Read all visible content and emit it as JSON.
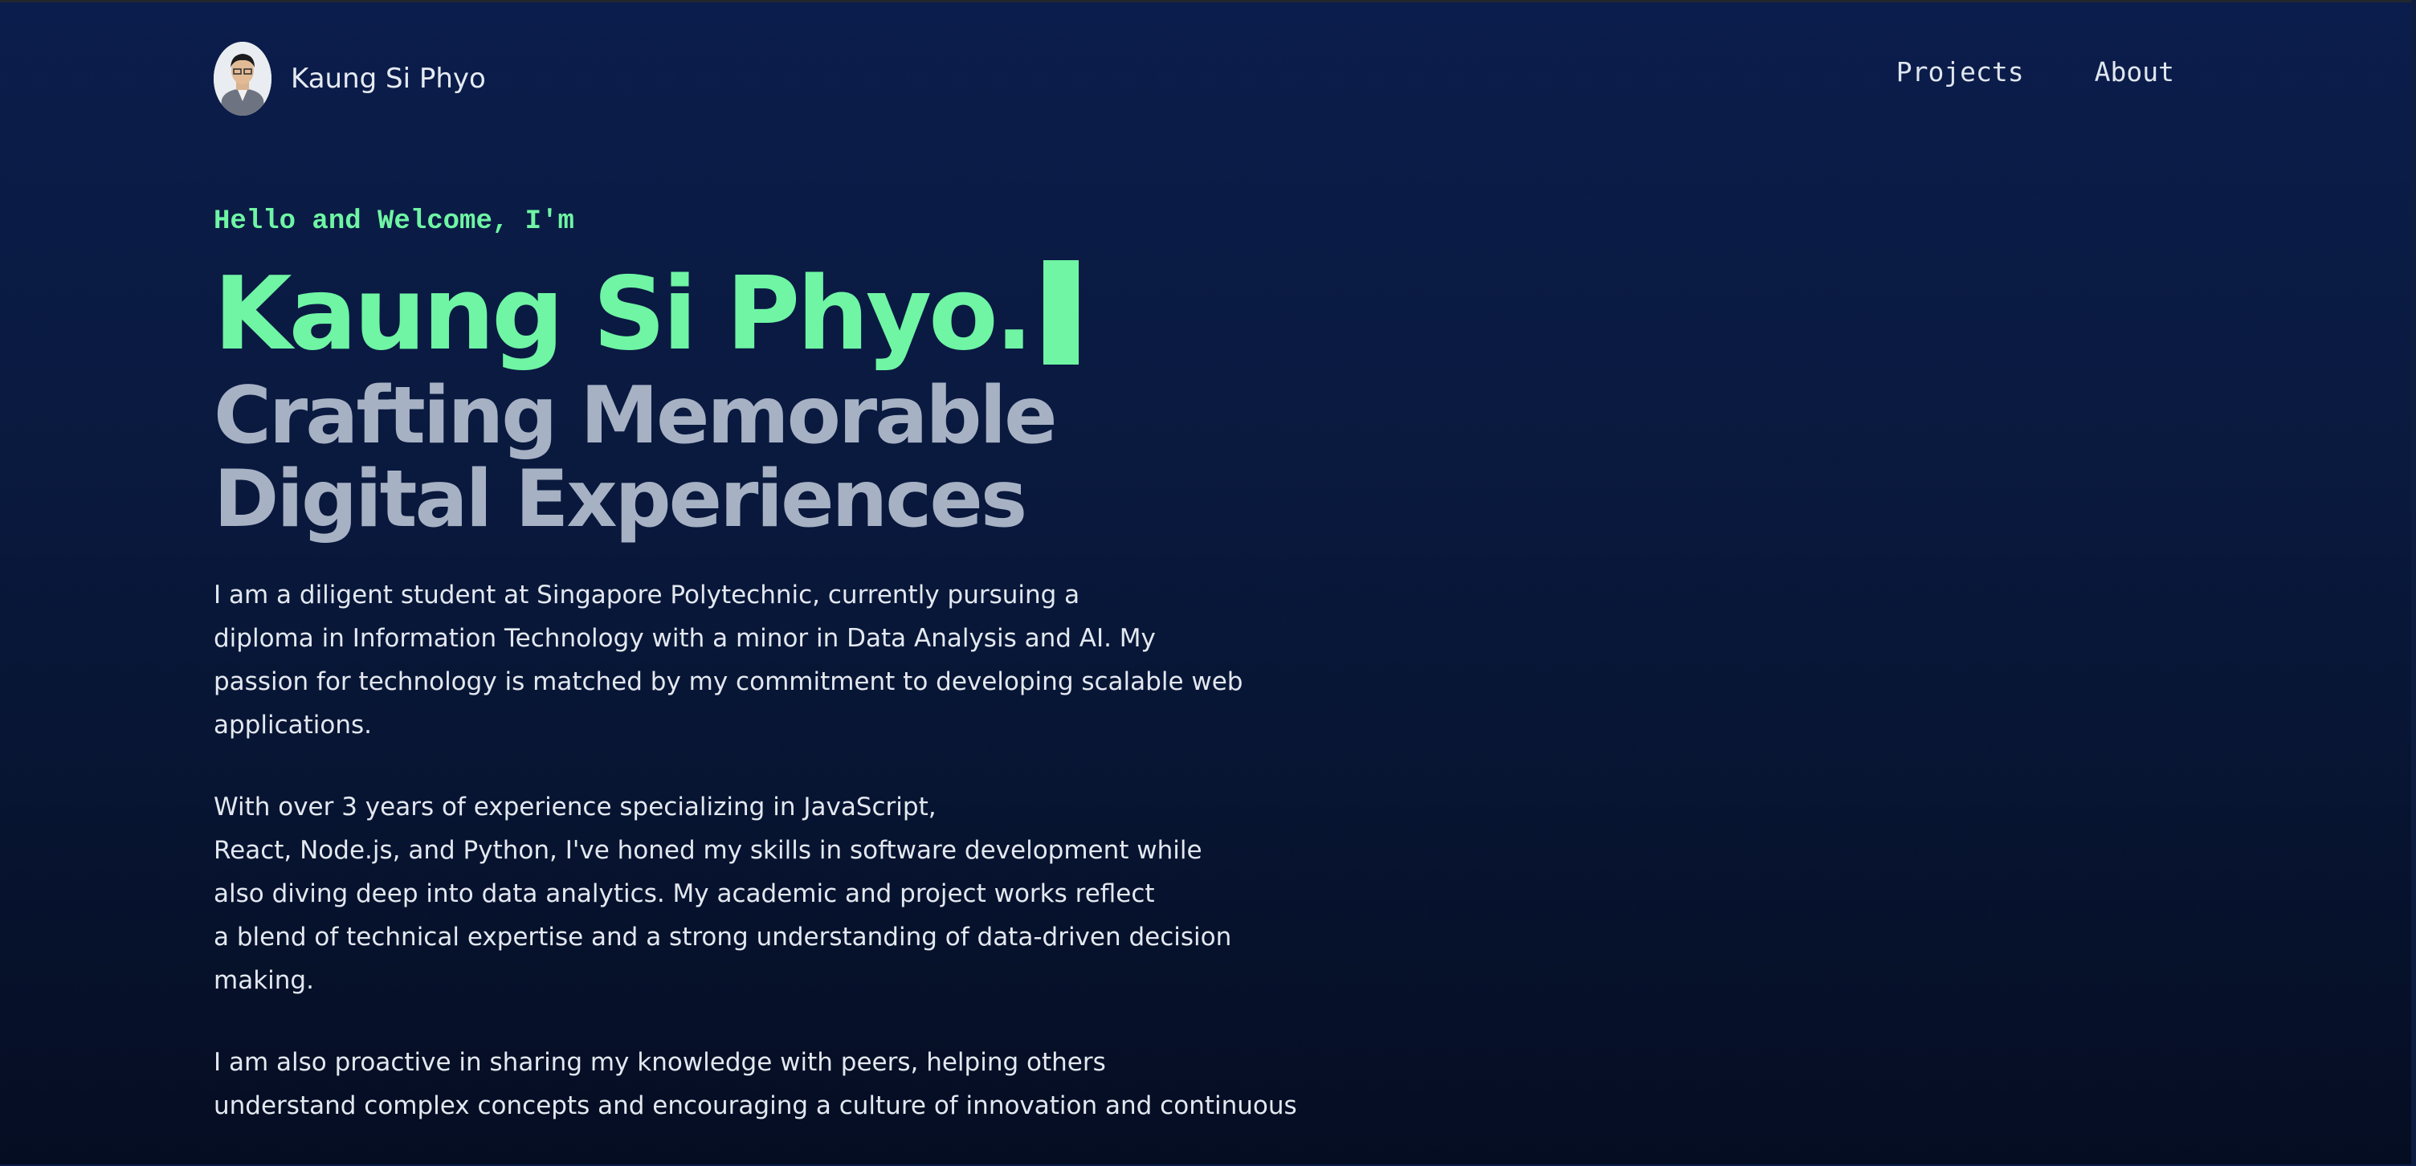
{
  "header": {
    "brand_name": "Kaung Si Phyo",
    "avatar_alt": "Kaung Si Phyo",
    "nav": [
      "Projects",
      "About"
    ]
  },
  "hero": {
    "greeting": "Hello and Welcome, I'm",
    "name": "Kaung Si Phyo.",
    "tagline_lines": [
      "Crafting Memorable",
      "Digital Experiences"
    ]
  },
  "bio": {
    "paragraphs": [
      [
        "I am a diligent student at Singapore Polytechnic, currently pursuing a",
        "diploma in Information Technology with a minor in Data Analysis and AI. My",
        "passion for technology is matched by my commitment to developing scalable web",
        "applications."
      ],
      [
        "With over 3 years of experience specializing in JavaScript,",
        "React, Node.js, and Python, I've honed my skills in software development while",
        "also diving deep into data analytics. My academic and project works reflect",
        "a blend of technical expertise and a strong understanding of data-driven decision",
        "making."
      ],
      [
        "I am also proactive in sharing my knowledge with peers, helping others",
        "understand complex concepts and encouraging a culture of innovation and continuous"
      ]
    ]
  },
  "colors": {
    "accent": "#6ff5a4",
    "tagline": "#a7b1c4",
    "text": "#e3e8f0",
    "background_top": "#0b1d4c",
    "background_bottom": "#050d22"
  },
  "icons": {
    "cursor": "text-cursor-block"
  }
}
